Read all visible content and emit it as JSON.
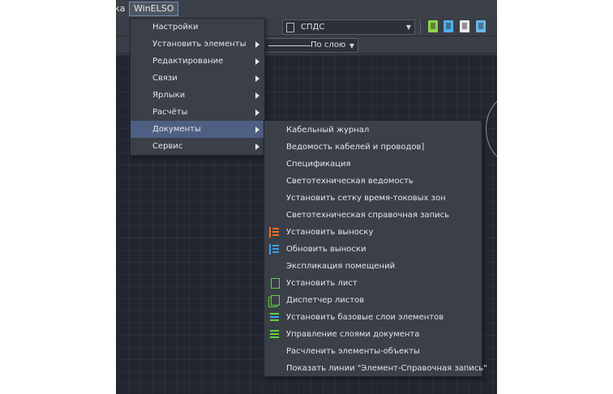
{
  "menubar": {
    "prev_label": "ка",
    "winelso_label": "WinELSO"
  },
  "toolbar": {
    "style_combo": "СПДС",
    "line_combo": "По слою"
  },
  "winelso_menu": {
    "items": [
      {
        "label": "Настройки",
        "submenu": false
      },
      {
        "label": "Установить элементы",
        "submenu": true
      },
      {
        "label": "Редактирование",
        "submenu": true
      },
      {
        "label": "Связи",
        "submenu": true
      },
      {
        "label": "Ярлыки",
        "submenu": true
      },
      {
        "label": "Расчёты",
        "submenu": true
      },
      {
        "label": "Документы",
        "submenu": true
      },
      {
        "label": "Сервис",
        "submenu": true
      }
    ],
    "active": "Документы"
  },
  "documents_menu": {
    "items": [
      {
        "label": "Кабельный журнал",
        "icon": ""
      },
      {
        "label": "Ведомость кабелей и проводов]",
        "icon": ""
      },
      {
        "label": "Спецификация",
        "icon": ""
      },
      {
        "label": "Светотехническая ведомость",
        "icon": ""
      },
      {
        "label": "Установить сетку время-токовых зон",
        "icon": ""
      },
      {
        "label": "Светотехническая справочная запись",
        "icon": ""
      },
      {
        "label": "Установить выноску",
        "icon": "leader-orange-icon"
      },
      {
        "label": "Обновить выноски",
        "icon": "leader-blue-icon"
      },
      {
        "label": "Экспликация помещений",
        "icon": ""
      },
      {
        "label": "Установить лист",
        "icon": "sheet-icon"
      },
      {
        "label": "Диспетчер листов",
        "icon": "sheets-manager-icon"
      },
      {
        "label": "Установить базовые слои элементов",
        "icon": "base-layers-icon"
      },
      {
        "label": "Управление слоями документа",
        "icon": "layers-manager-icon"
      },
      {
        "label": "Расчленить элементы-объекты",
        "icon": ""
      },
      {
        "label": "Показать линии \"Элемент-Справочная запись\"",
        "icon": ""
      }
    ]
  },
  "colors": {
    "menu_bg": "#3b3f48",
    "highlight": "#4d5f82",
    "canvas": "#212631"
  }
}
